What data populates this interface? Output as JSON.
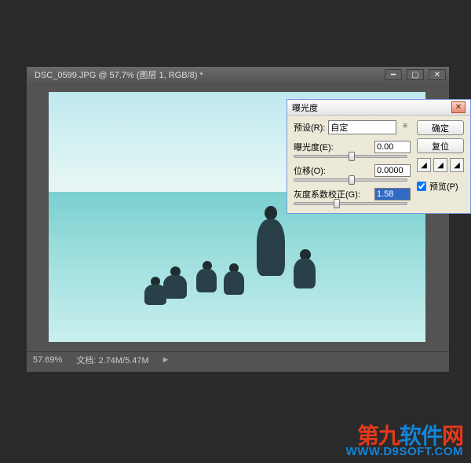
{
  "document": {
    "tab_title": "DSC_0599.JPG @ 57.7% (图层 1, RGB/8) *",
    "zoom": "57.69%",
    "doc_label": "文档:",
    "doc_size": "2.74M/5.47M"
  },
  "dialog": {
    "title": "曝光度",
    "preset_label": "预设(R):",
    "preset_value": "自定",
    "exposure_label": "曝光度(E):",
    "exposure_value": "0.00",
    "offset_label": "位移(O):",
    "offset_value": "0.0000",
    "gamma_label": "灰度系数校正(G):",
    "gamma_value": "1.58",
    "ok_label": "确定",
    "reset_label": "复位",
    "preview_label": "预览(P)"
  },
  "watermark": {
    "line1_a": "第九",
    "line1_b": "软件",
    "line1_c": "网",
    "url": "WWW.D9SOFT.COM"
  }
}
